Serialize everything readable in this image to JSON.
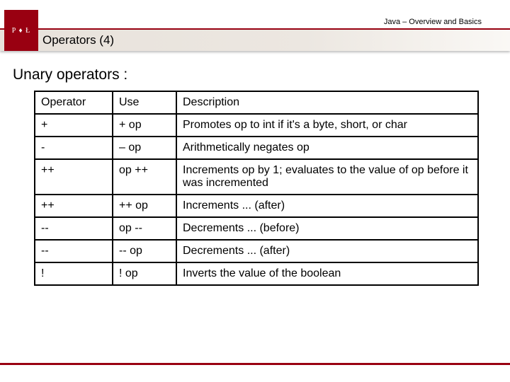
{
  "header": {
    "topic": "Java – Overview and Basics",
    "logo_text": "P ♦ Ł",
    "slide_title": "Operators (4)"
  },
  "section_heading": "Unary operators :",
  "table": {
    "headers": [
      "Operator",
      "Use",
      "Description"
    ],
    "rows": [
      {
        "operator": "+",
        "use": "+ op",
        "description": "Promotes op to int if it's a byte, short, or char"
      },
      {
        "operator": "-",
        "use": "– op",
        "description": "Arithmetically negates op"
      },
      {
        "operator": "++",
        "use": "op ++",
        "description": "Increments op by 1; evaluates to the value of op before it was incremented"
      },
      {
        "operator": "++",
        "use": "++ op",
        "description": "Increments ... (after)"
      },
      {
        "operator": "--",
        "use": "op --",
        "description": "Decrements ... (before)"
      },
      {
        "operator": "--",
        "use": "-- op",
        "description": "Decrements ... (after)"
      },
      {
        "operator": "!",
        "use": "! op",
        "description": "Inverts the value of the boolean"
      }
    ]
  }
}
